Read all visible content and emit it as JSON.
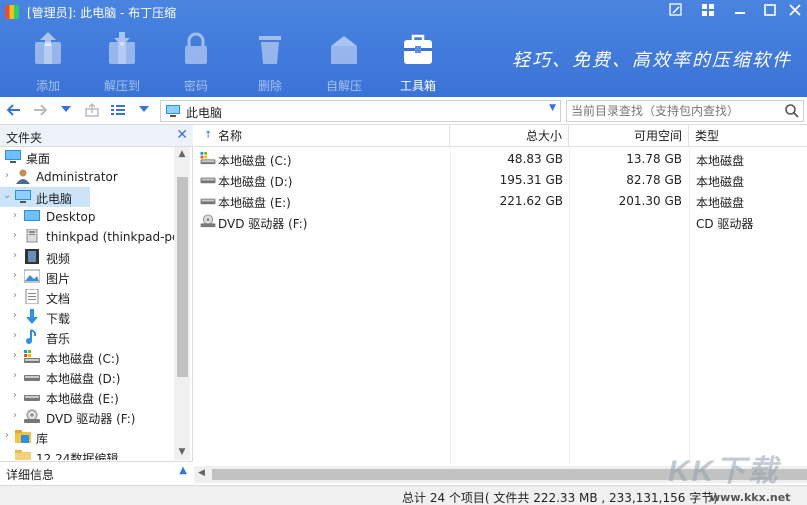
{
  "window": {
    "title": "[管理员]: 此电脑 - 布丁压缩",
    "buttons": [
      "edit",
      "settings",
      "minimize",
      "close"
    ]
  },
  "toolbar": {
    "add": "添加",
    "extract": "解压到",
    "password": "密码",
    "delete": "删除",
    "sfx": "自解压",
    "tools": "工具箱",
    "slogan": "轻巧、免费、高效率的压缩软件"
  },
  "nav": {
    "address": "此电脑",
    "search_placeholder": "当前目录查找（支持包内查找）"
  },
  "sidebar": {
    "header": "文件夹",
    "items": [
      {
        "label": "桌面",
        "icon": "desktop-icon"
      },
      {
        "label": "Administrator",
        "icon": "user-icon"
      },
      {
        "label": "此电脑",
        "icon": "computer-icon"
      },
      {
        "label": "Desktop",
        "icon": "desktop-icon"
      },
      {
        "label": "thinkpad (thinkpad-pc",
        "icon": "network-icon"
      },
      {
        "label": "视频",
        "icon": "video-icon"
      },
      {
        "label": "图片",
        "icon": "picture-icon"
      },
      {
        "label": "文档",
        "icon": "document-icon"
      },
      {
        "label": "下载",
        "icon": "download-icon"
      },
      {
        "label": "音乐",
        "icon": "music-icon"
      },
      {
        "label": "本地磁盘 (C:)",
        "icon": "drive-icon"
      },
      {
        "label": "本地磁盘 (D:)",
        "icon": "drive-icon"
      },
      {
        "label": "本地磁盘 (E:)",
        "icon": "drive-icon"
      },
      {
        "label": "DVD 驱动器 (F:)",
        "icon": "dvd-icon"
      },
      {
        "label": "库",
        "icon": "library-icon"
      },
      {
        "label": "12.24数据编辑",
        "icon": "folder-icon"
      }
    ],
    "detail": "详细信息"
  },
  "list": {
    "columns": [
      "名称",
      "总大小",
      "可用空间",
      "类型"
    ],
    "rows": [
      {
        "name": "本地磁盘 (C:)",
        "total": "48.83 GB",
        "free": "13.78 GB",
        "type": "本地磁盘"
      },
      {
        "name": "本地磁盘 (D:)",
        "total": "195.31 GB",
        "free": "82.78 GB",
        "type": "本地磁盘"
      },
      {
        "name": "本地磁盘 (E:)",
        "total": "221.62 GB",
        "free": "201.30 GB",
        "type": "本地磁盘"
      },
      {
        "name": "DVD 驱动器 (F:)",
        "total": "",
        "free": "",
        "type": "CD 驱动器"
      }
    ]
  },
  "status": {
    "text": "总计 24 个项目( 文件共 222.33 MB , 233,131,156 字节)"
  },
  "watermark": {
    "logo": "KK下载",
    "url": "www.kkx.net"
  },
  "colors": {
    "toolbar_bg": "#3a73d6",
    "accent": "#3a73d6",
    "selection": "#cce4f7"
  }
}
